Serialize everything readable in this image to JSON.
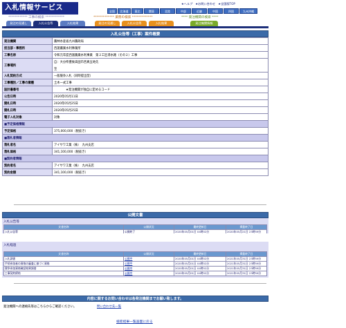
{
  "header": {
    "logo_text": "入札情報サービス",
    "top_links": [
      "★ヘルプ",
      "★お問い合わせ",
      "★全国版TOP"
    ],
    "regions": [
      "全国",
      "北海道",
      "東北",
      "関東",
      "北陸",
      "中部",
      "近畿",
      "中国",
      "四国",
      "九州沖縄"
    ],
    "categories": {
      "kouji": "************ 工事の検索 ************",
      "gyomu": "************* 業務の検索 *************",
      "buppin": "**** 発注機関の検索 ****"
    },
    "tabs": [
      "発注の見通し",
      "入札公告等",
      "入札結果",
      "発注の見通し",
      "入札公告等",
      "入札結果",
      "発注機関情報"
    ]
  },
  "case": {
    "title": "入札公告等（工事）案件概要",
    "rows": [
      {
        "k": "発注機関",
        "v": "農林水産省九州農政局"
      },
      {
        "k": "担当部・事務所",
        "v": "西諸農業水利事業所"
      },
      {
        "k": "工事名称",
        "v": "令和元年度西諸農業水利事業　第２工区導水路（その２）工事"
      },
      {
        "k": "工事場所",
        "v": "自：大分県豊後高田市西真玉地先",
        "v2": "至"
      },
      {
        "k": "入札契約方式",
        "v": "一般競争入札（同時提出型）"
      },
      {
        "k": "工事種別／工事の業種",
        "v": "土木一式工事"
      },
      {
        "k": "設計書番号",
        "v": "　　　　★発注機関が独自に定めるコード"
      },
      {
        "k": "公告日時",
        "v": "2020年05月11日"
      },
      {
        "k": "開札日時",
        "v": "2020年05月25日"
      },
      {
        "k": "開札日時",
        "v": "2020年05月25日"
      },
      {
        "k": "電子入札対象",
        "v": "対象"
      }
    ],
    "yotei_header": "■予定価格情報",
    "yotei_rows": [
      {
        "k": "予定価格",
        "v": "375,000,000（税抜き）"
      }
    ],
    "rakusatsu_header": "■落札者情報",
    "rakusatsu_rows": [
      {
        "k": "落札者名",
        "v": "アイサワ工業（株）　九州支店"
      },
      {
        "k": "落札価格",
        "v": "341,100,000（税抜き）"
      }
    ],
    "keiyaku_header": "■契約者情報",
    "keiyaku_rows": [
      {
        "k": "契約者名",
        "v": "アイサワ工業（株）　九州支店"
      },
      {
        "k": "契約金額",
        "v": "341,100,000（税抜き）"
      }
    ]
  },
  "documents": {
    "title": "公開文書",
    "groups": [
      {
        "name": "入札公告等",
        "headers": [
          "文書名称",
          "公開状況",
          "最終更新日",
          "掲載終了日"
        ],
        "rows": [
          [
            "入札公告等",
            "公開終了",
            "2020年05月01日 04時02分",
            "2020年05月21日 23時59分"
          ]
        ]
      },
      {
        "name": "入札経過",
        "headers": [
          "文書名称",
          "公開状況",
          "最終更新日",
          "掲載終了日"
        ],
        "rows": [
          [
            "入札調書",
            "公開中",
            "2020年05月01日 04時02分",
            "2021年05月31日 23時59分"
          ],
          [
            "手続参加者の資格の審査に基づく資格",
            "公開中",
            "2020年05月01日 04時02分",
            "2021年05月31日 23時59分"
          ],
          [
            "競争参加資格確認結果調書",
            "公開中",
            "2020年05月01日 04時02分",
            "2021年05月31日 23時59分"
          ],
          [
            "工事契約締結",
            "公開中",
            "2020年05月01日 04時02分",
            "2021年05月31日 23時59分"
          ]
        ]
      }
    ]
  },
  "footer": {
    "notice": "内容に関するお問い合わせは各発注機関までお願い致します。",
    "contact_text": "発注機関への連絡先等はこちらからご確認ください。",
    "contact_link": "問い合わせ先一覧",
    "back_link": "検索結果一覧画面に戻る"
  }
}
